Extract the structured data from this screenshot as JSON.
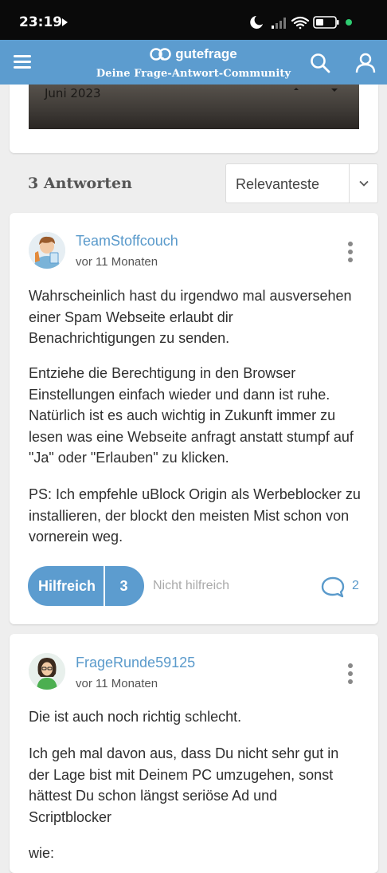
{
  "status_bar": {
    "time": "23:19",
    "icons": [
      "media-play-icon",
      "moon-icon",
      "signal-icon",
      "wifi-icon",
      "battery-icon",
      "dot-icon"
    ],
    "accent_dot_color": "#2ecc71"
  },
  "app_bar": {
    "brand": "gutefrage",
    "tagline": "Deine Frage-Antwort-Community",
    "color": "#5c9ccf"
  },
  "question_image": {
    "visible_text": "Juni 2023"
  },
  "answers": {
    "count_label": "3 Antworten",
    "sort_label": "Relevanteste",
    "items": [
      {
        "username": "TeamStoffcouch",
        "time": "vor 11 Monaten",
        "paragraphs": [
          "Wahrscheinlich hast du irgendwo mal ausversehen einer Spam Webseite erlaubt dir Benachrichtigungen zu senden.",
          "Entziehe die Berechtigung in den Browser Einstellungen einfach wieder und dann ist ruhe. Natürlich ist es auch wichtig in Zukunft immer zu lesen was eine Webseite anfragt anstatt stumpf auf \"Ja\" oder \"Erlauben\" zu klicken.",
          "PS: Ich empfehle uBlock Origin als Werbeblocker zu installieren, der blockt den meisten Mist schon von vornerein weg."
        ],
        "helpful_label": "Hilfreich",
        "helpful_count": "3",
        "not_helpful_label": "Nicht hilfreich",
        "comment_count": "2"
      },
      {
        "username": "FrageRunde59125",
        "time": "vor 11 Monaten",
        "paragraphs": [
          "Die ist auch noch richtig schlecht.",
          "Ich geh mal davon aus, dass Du nicht sehr gut in der Lage bist mit Deinem PC umzugehen, sonst hättest Du schon längst seriöse Ad und Scriptblocker",
          "wie:"
        ]
      }
    ]
  }
}
